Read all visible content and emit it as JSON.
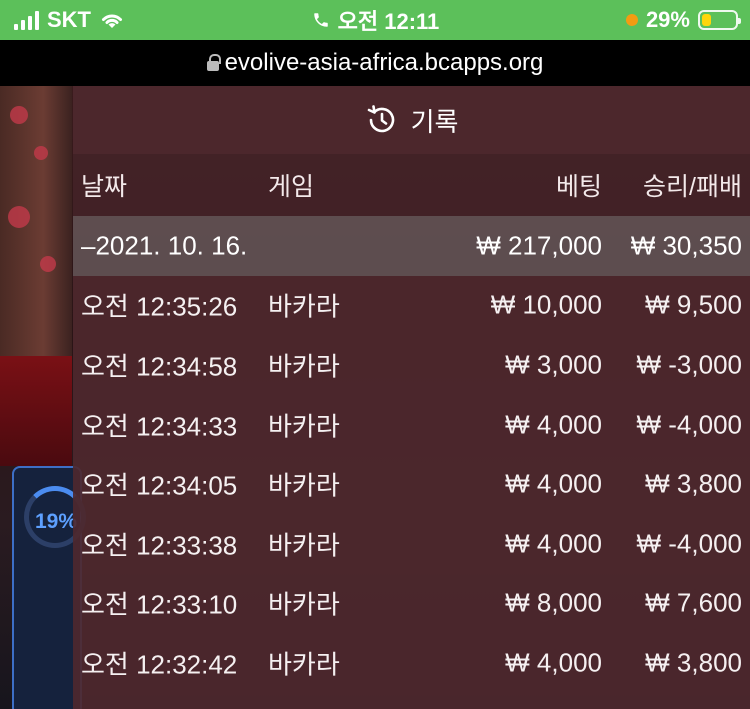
{
  "status_bar": {
    "carrier": "SKT",
    "time": "오전 12:11",
    "battery_percent": "29%",
    "battery_level": 0.29,
    "accent": "#5cc05a"
  },
  "url_bar": {
    "url": "evolive-asia-africa.bcapps.org"
  },
  "game": {
    "timer_label": "19%"
  },
  "history_panel": {
    "title": "기록",
    "icon": "history-icon",
    "columns": [
      "날짜",
      "게임",
      "베팅",
      "승리/패배"
    ],
    "summary": {
      "date": "–2021. 10. 16.",
      "bet": "₩ 217,000",
      "result": "₩ 30,350"
    },
    "rows": [
      {
        "time": "오전 12:35:26",
        "game": "바카라",
        "bet": "₩ 10,000",
        "result": "₩ 9,500"
      },
      {
        "time": "오전 12:34:58",
        "game": "바카라",
        "bet": "₩ 3,000",
        "result": "₩ -3,000"
      },
      {
        "time": "오전 12:34:33",
        "game": "바카라",
        "bet": "₩ 4,000",
        "result": "₩ -4,000"
      },
      {
        "time": "오전 12:34:05",
        "game": "바카라",
        "bet": "₩ 4,000",
        "result": "₩ 3,800"
      },
      {
        "time": "오전 12:33:38",
        "game": "바카라",
        "bet": "₩ 4,000",
        "result": "₩ -4,000"
      },
      {
        "time": "오전 12:33:10",
        "game": "바카라",
        "bet": "₩ 8,000",
        "result": "₩ 7,600"
      },
      {
        "time": "오전 12:32:42",
        "game": "바카라",
        "bet": "₩ 4,000",
        "result": "₩ 3,800"
      }
    ]
  }
}
